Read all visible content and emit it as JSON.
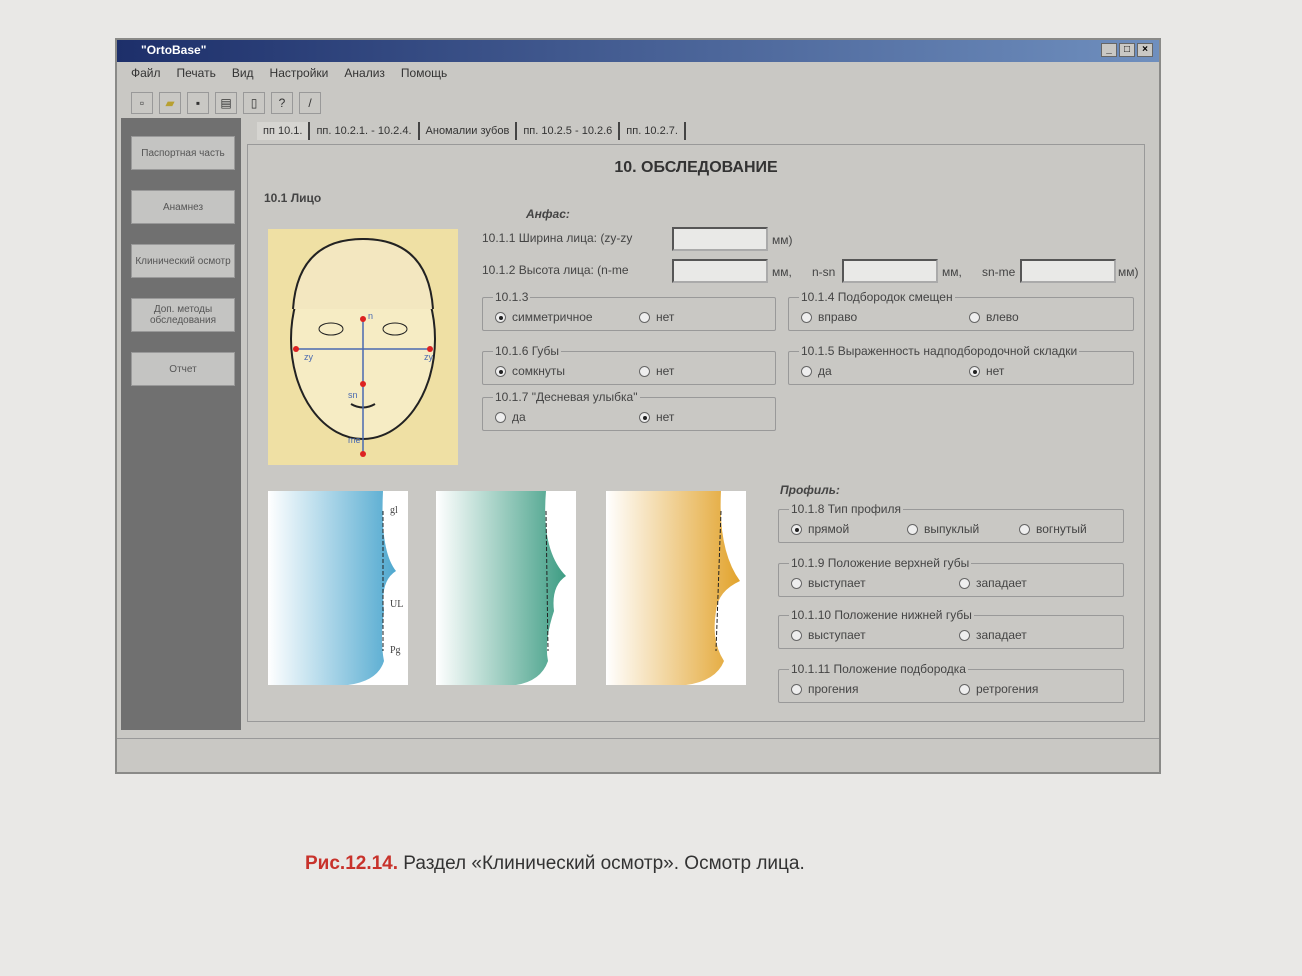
{
  "window": {
    "title": "\"OrtoBase\"",
    "controls": [
      "_",
      "□",
      "×"
    ]
  },
  "menu": [
    "Файл",
    "Печать",
    "Вид",
    "Настройки",
    "Анализ",
    "Помощь"
  ],
  "sidebar": [
    "Паспортная часть",
    "Анамнез",
    "Клинический осмотр",
    "Доп. методы обследования",
    "Отчет"
  ],
  "tabs": [
    "пп 10.1.",
    "пп. 10.2.1. - 10.2.4.",
    "Аномалии зубов",
    "пп. 10.2.5 - 10.2.6",
    "пп. 10.2.7."
  ],
  "panel": {
    "title": "10. ОБСЛЕДОВАНИЕ",
    "section": "10.1 Лицо",
    "anfas": "Анфас:",
    "f1": {
      "label": "10.1.1  Ширина лица: (zy-zy",
      "unit": "мм)",
      "value": ""
    },
    "f2": {
      "label": "10.1.2  Высота лица: (n-me",
      "unit1": "мм,",
      "label2": "n-sn",
      "unit2": "мм,",
      "label3": "sn-me",
      "unit3": "мм)"
    },
    "g3": {
      "legend": "10.1.3",
      "opts": [
        "симметричное",
        "нет"
      ]
    },
    "g4": {
      "legend": "10.1.4 Подбородок смещен",
      "opts": [
        "вправо",
        "влево"
      ]
    },
    "g6": {
      "legend": "10.1.6 Губы",
      "opts": [
        "сомкнуты",
        "нет"
      ]
    },
    "g5": {
      "legend": "10.1.5 Выраженность надподбородочной складки",
      "opts": [
        "да",
        "нет"
      ]
    },
    "g7": {
      "legend": "10.1.7 \"Десневая улыбка\"",
      "opts": [
        "да",
        "нет"
      ]
    },
    "profile": "Профиль:",
    "g8": {
      "legend": "10.1.8 Тип профиля",
      "opts": [
        "прямой",
        "выпуклый",
        "вогнутый"
      ]
    },
    "g9": {
      "legend": "10.1.9 Положение верхней губы",
      "opts": [
        "выступает",
        "западает"
      ]
    },
    "g10": {
      "legend": "10.1.10 Положение нижней губы",
      "opts": [
        "выступает",
        "западает"
      ]
    },
    "g11": {
      "legend": "10.1.11 Положение подбородка",
      "opts": [
        "прогения",
        "ретрогения"
      ]
    },
    "face_labels": [
      "zy",
      "zy",
      "n",
      "sn",
      "me"
    ],
    "profile_labels": [
      "gl",
      "UL",
      "Pg"
    ]
  },
  "caption": {
    "num": "Рис.12.14.",
    "text": " Раздел «Клинический осмотр». Осмотр лица."
  }
}
